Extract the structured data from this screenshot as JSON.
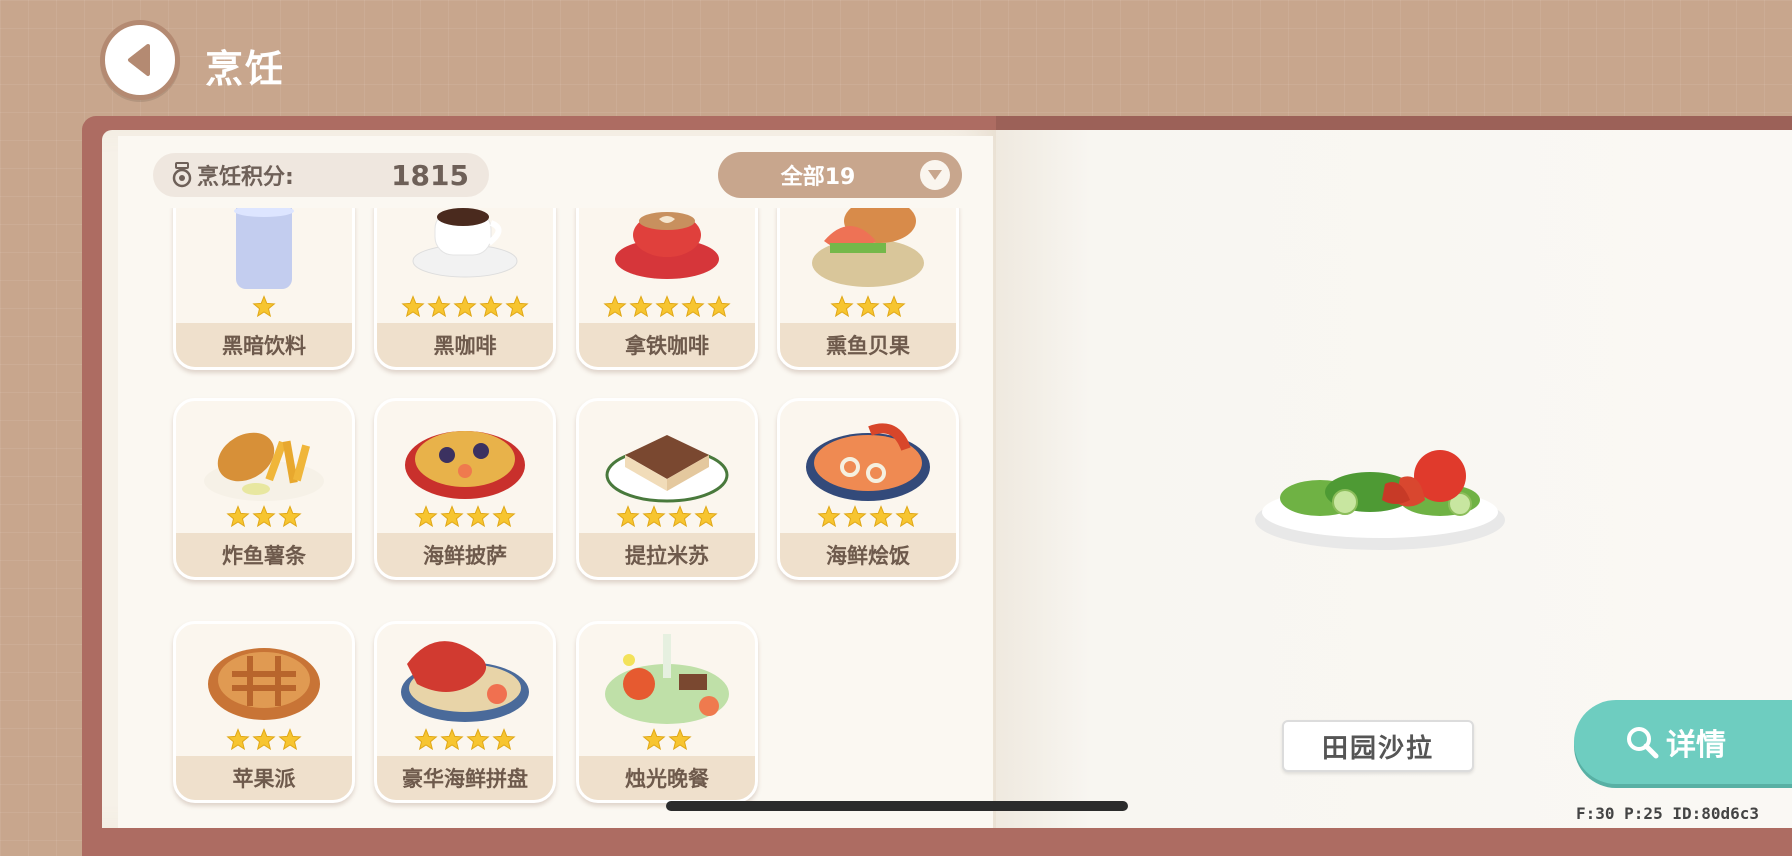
{
  "header": {
    "title": "烹饪"
  },
  "score": {
    "label": "烹饪积分:",
    "value": "1815"
  },
  "filter": {
    "label": "全部19"
  },
  "recipes": [
    {
      "name": "黑暗饮料",
      "stars": 1,
      "icon": "dark-drink-icon"
    },
    {
      "name": "黑咖啡",
      "stars": 5,
      "icon": "black-coffee-icon"
    },
    {
      "name": "拿铁咖啡",
      "stars": 5,
      "icon": "latte-icon"
    },
    {
      "name": "熏鱼贝果",
      "stars": 3,
      "icon": "smoked-fish-bagel-icon"
    },
    {
      "name": "炸鱼薯条",
      "stars": 3,
      "icon": "fish-and-chips-icon"
    },
    {
      "name": "海鲜披萨",
      "stars": 4,
      "icon": "seafood-pizza-icon"
    },
    {
      "name": "提拉米苏",
      "stars": 4,
      "icon": "tiramisu-icon"
    },
    {
      "name": "海鲜烩饭",
      "stars": 4,
      "icon": "seafood-paella-icon"
    },
    {
      "name": "苹果派",
      "stars": 3,
      "icon": "apple-pie-icon"
    },
    {
      "name": "豪华海鲜拼盘",
      "stars": 4,
      "icon": "seafood-platter-icon"
    },
    {
      "name": "烛光晚餐",
      "stars": 2,
      "icon": "candlelight-dinner-icon"
    }
  ],
  "selected": {
    "name": "田园沙拉"
  },
  "detail_button": {
    "label": "详情"
  },
  "debug": {
    "text": "F:30  P:25  ID:80d6c3"
  },
  "colors": {
    "star": "#f7c530",
    "accent": "#6ecdc0",
    "book": "#ad6c62",
    "background": "#c8a68d"
  }
}
